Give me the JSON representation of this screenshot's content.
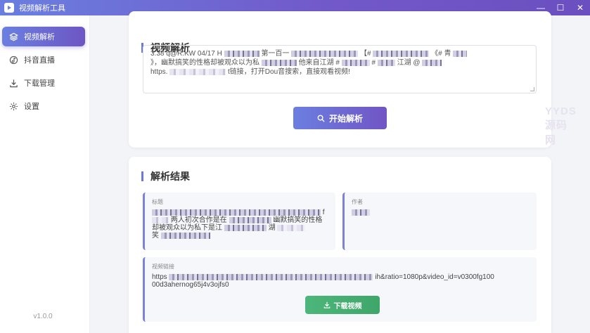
{
  "window": {
    "title": "视频解析工具",
    "controls": {
      "minimize": "—",
      "maximize": "☐",
      "close": "✕"
    }
  },
  "sidebar": {
    "items": [
      {
        "label": "视频解析",
        "icon": "layers-icon",
        "active": true
      },
      {
        "label": "抖音直播",
        "icon": "music-note-icon",
        "active": false
      },
      {
        "label": "下载管理",
        "icon": "download-icon",
        "active": false
      },
      {
        "label": "设置",
        "icon": "gear-icon",
        "active": false
      }
    ],
    "version": "v1.0.0"
  },
  "parse_section": {
    "title": "视频解析",
    "input": {
      "line1_a": "3.38 q@R.KW 04/17 H",
      "line1_b": "第一百一",
      "line1_c": "【#",
      "line1_d": "《# 青",
      "line2_a": "》，幽默搞笑的性格却被观众以为私",
      "line2_b": "他来自江湖 #",
      "line2_c": "#",
      "line2_d": "江湖 @",
      "line3_a": "https.",
      "line3_b": "t链接，打开Dou音搜索，直接观看视频!"
    },
    "button_label": "开始解析"
  },
  "watermark": "YYDS源码网",
  "result_section": {
    "title": "解析结果",
    "title_field": {
      "label": "标题",
      "line1_end": "f",
      "line2_a": "两人初次合作是在",
      "line2_b": "幽默搞笑的性格",
      "line3_a": "却被观众以为私下是江",
      "line3_b": "湖",
      "line4": "笑"
    },
    "author_field": {
      "label": "作者"
    },
    "link_field": {
      "label": "视频链接",
      "line1_a": "https",
      "line1_b": "ih&ratio=1080p&video_id=v0300fg100",
      "line2": "00d3ahernog65j4v3ojfs0"
    },
    "download_button": "下载视频"
  },
  "colors": {
    "accent_start": "#6b7fe0",
    "accent_end": "#7155c4",
    "download_green": "#45ae70"
  }
}
